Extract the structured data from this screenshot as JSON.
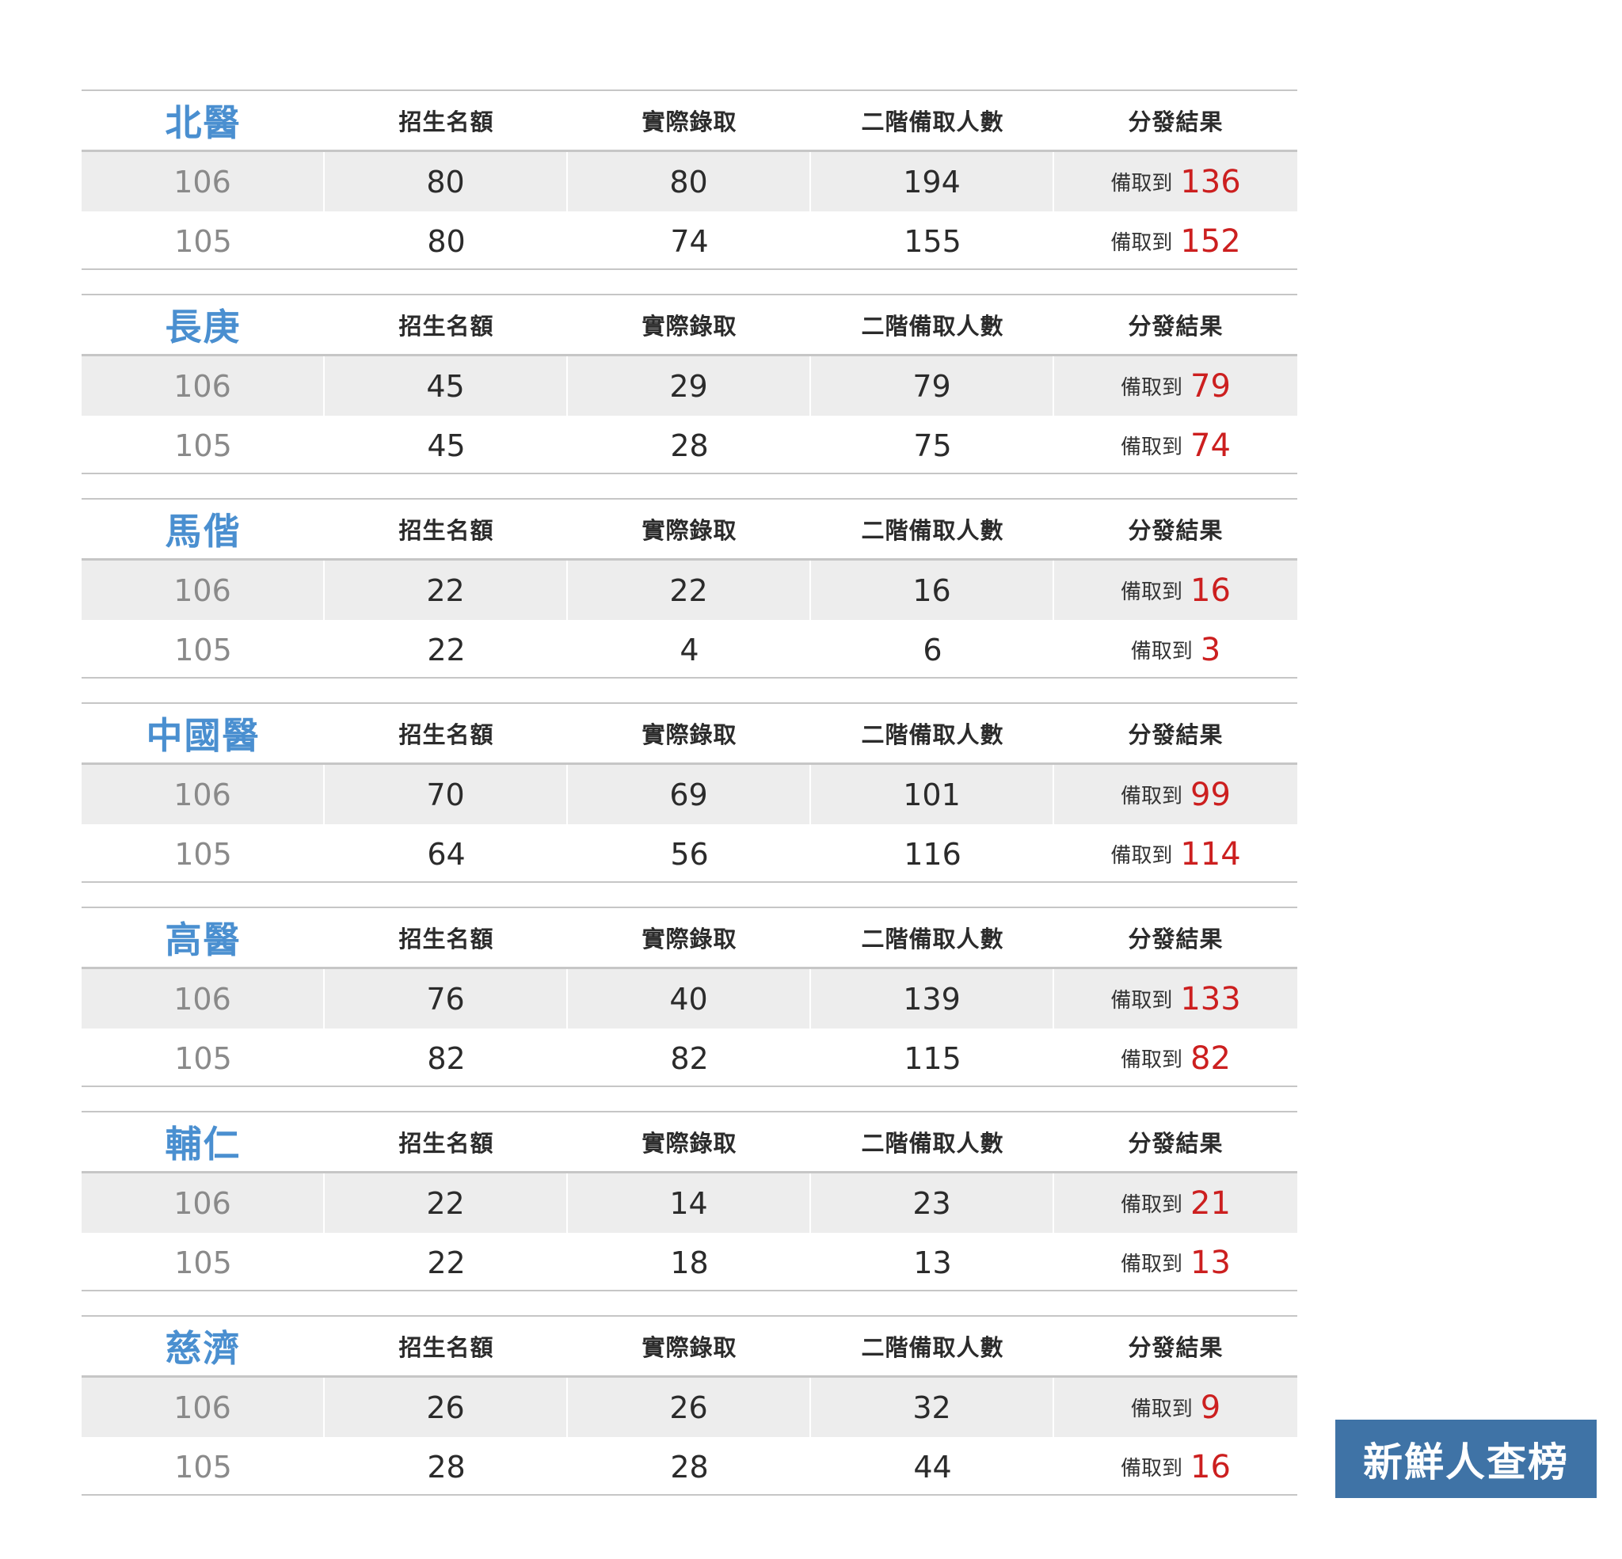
{
  "headers": [
    "招生名額",
    "實際錄取",
    "二階備取人數",
    "分發結果"
  ],
  "result_prefix": "備取到",
  "schools": [
    {
      "name": "北醫",
      "rows": [
        {
          "year": "106",
          "quota": "80",
          "admitted": "80",
          "waitlist": "194",
          "result": "136"
        },
        {
          "year": "105",
          "quota": "80",
          "admitted": "74",
          "waitlist": "155",
          "result": "152"
        }
      ]
    },
    {
      "name": "長庚",
      "rows": [
        {
          "year": "106",
          "quota": "45",
          "admitted": "29",
          "waitlist": "79",
          "result": "79"
        },
        {
          "year": "105",
          "quota": "45",
          "admitted": "28",
          "waitlist": "75",
          "result": "74"
        }
      ]
    },
    {
      "name": "馬偕",
      "rows": [
        {
          "year": "106",
          "quota": "22",
          "admitted": "22",
          "waitlist": "16",
          "result": "16"
        },
        {
          "year": "105",
          "quota": "22",
          "admitted": "4",
          "waitlist": "6",
          "result": "3"
        }
      ]
    },
    {
      "name": "中國醫",
      "rows": [
        {
          "year": "106",
          "quota": "70",
          "admitted": "69",
          "waitlist": "101",
          "result": "99"
        },
        {
          "year": "105",
          "quota": "64",
          "admitted": "56",
          "waitlist": "116",
          "result": "114"
        }
      ]
    },
    {
      "name": "高醫",
      "rows": [
        {
          "year": "106",
          "quota": "76",
          "admitted": "40",
          "waitlist": "139",
          "result": "133"
        },
        {
          "year": "105",
          "quota": "82",
          "admitted": "82",
          "waitlist": "115",
          "result": "82"
        }
      ]
    },
    {
      "name": "輔仁",
      "rows": [
        {
          "year": "106",
          "quota": "22",
          "admitted": "14",
          "waitlist": "23",
          "result": "21"
        },
        {
          "year": "105",
          "quota": "22",
          "admitted": "18",
          "waitlist": "13",
          "result": "13"
        }
      ]
    },
    {
      "name": "慈濟",
      "rows": [
        {
          "year": "106",
          "quota": "26",
          "admitted": "26",
          "waitlist": "32",
          "result": "9"
        },
        {
          "year": "105",
          "quota": "28",
          "admitted": "28",
          "waitlist": "44",
          "result": "16"
        }
      ]
    }
  ],
  "brand": {
    "label": "新鮮人查榜"
  },
  "colors": {
    "school_name": "#4a8fd0",
    "result_number": "#cc1f1f",
    "stripe": "#ededed",
    "rule": "#c6c6c6",
    "brand_bg": "#3f73a6"
  }
}
